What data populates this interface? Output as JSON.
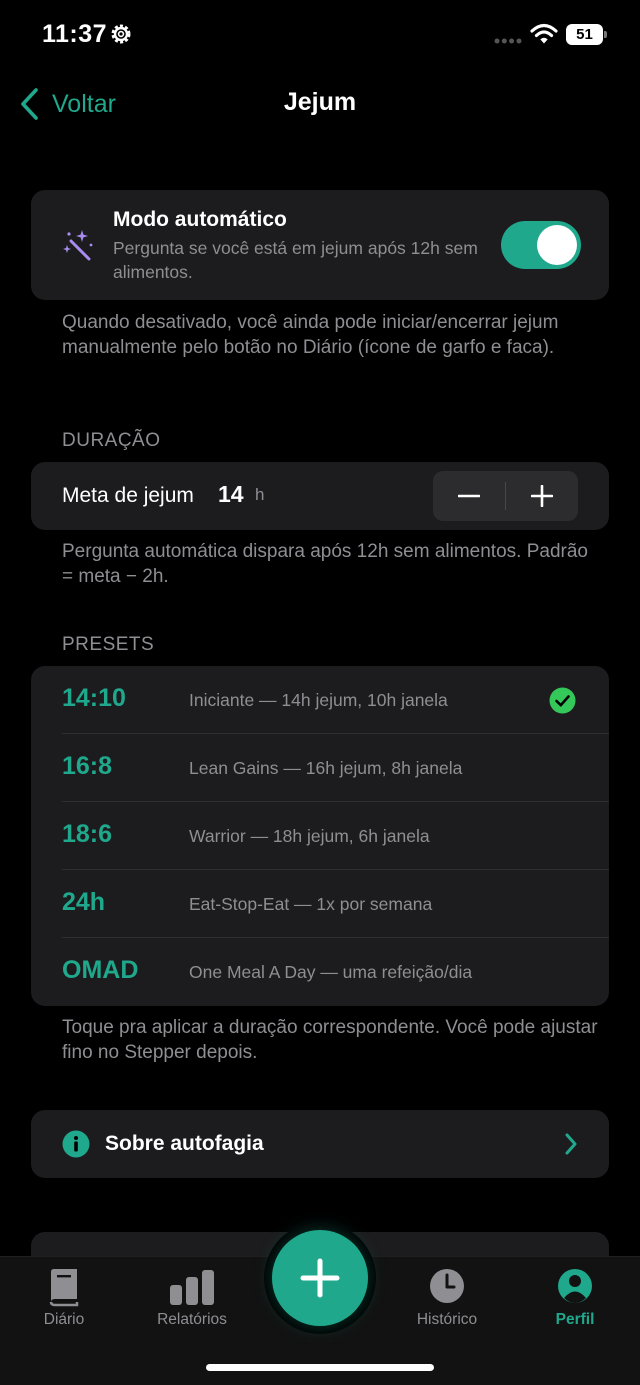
{
  "status_bar": {
    "time": "11:37",
    "battery": "51"
  },
  "nav": {
    "back_label": "Voltar",
    "title": "Jejum"
  },
  "auto_mode": {
    "title": "Modo automático",
    "description": "Pergunta se você está em jejum após 12h sem alimentos.",
    "enabled": true,
    "footnote": "Quando desativado, você ainda pode iniciar/encerrar jejum manualmente pelo botão no Diário (ícone de garfo e faca)."
  },
  "duration": {
    "header": "DURAÇÃO",
    "label": "Meta de jejum",
    "value": "14",
    "unit": "h",
    "footnote": "Pergunta automática dispara após 12h sem alimentos. Padrão = meta − 2h."
  },
  "presets": {
    "header": "PRESETS",
    "items": [
      {
        "code": "14:10",
        "description": "Iniciante — 14h jejum, 10h janela",
        "selected": true
      },
      {
        "code": "16:8",
        "description": "Lean Gains — 16h jejum, 8h janela",
        "selected": false
      },
      {
        "code": "18:6",
        "description": "Warrior — 18h jejum, 6h janela",
        "selected": false
      },
      {
        "code": "24h",
        "description": "Eat-Stop-Eat — 1x por semana",
        "selected": false
      },
      {
        "code": "OMAD",
        "description": "One Meal A Day — uma refeição/dia",
        "selected": false
      }
    ],
    "footnote": "Toque pra aplicar a duração correspondente. Você pode ajustar fino no Stepper depois."
  },
  "about": {
    "label": "Sobre autofagia"
  },
  "tab_bar": {
    "tabs": [
      {
        "label": "Diário",
        "icon": "book-icon",
        "active": false
      },
      {
        "label": "Relatórios",
        "icon": "bar-chart-icon",
        "active": false
      },
      {
        "label": "Histórico",
        "icon": "clock-icon",
        "active": false
      },
      {
        "label": "Perfil",
        "icon": "person-icon",
        "active": true
      }
    ]
  },
  "colors": {
    "accent": "#1fa88c",
    "card": "#1c1c1e",
    "secondary_text": "#8e8e93",
    "check": "#34c759"
  }
}
